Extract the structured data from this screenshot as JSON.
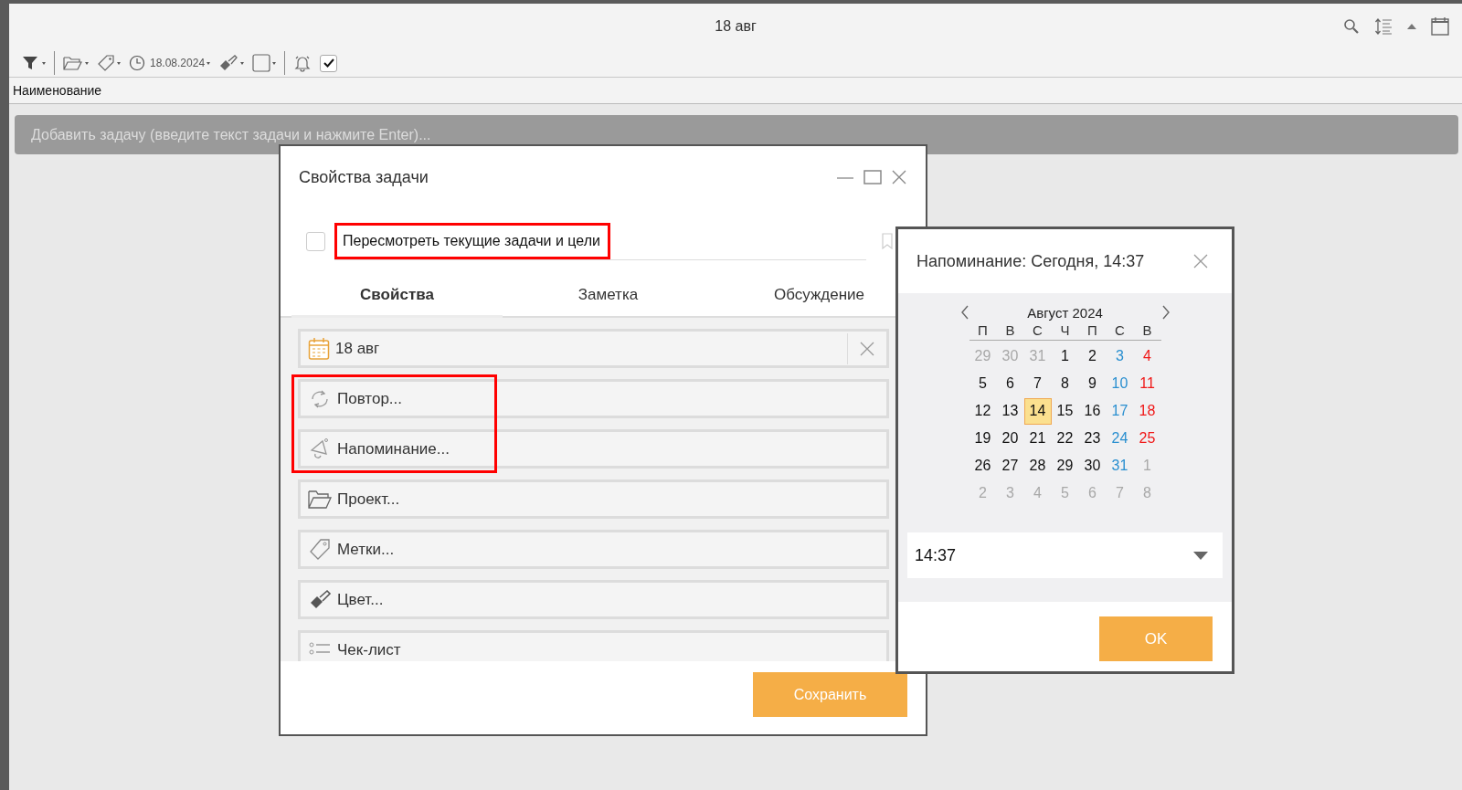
{
  "window": {
    "title": "18 авг"
  },
  "toolbar": {
    "date": "18.08.2024",
    "show_completed": true
  },
  "list": {
    "columns": [
      {
        "label": "Наименование"
      }
    ],
    "add_task": {
      "placeholder": "Добавить задачу (введите текст задачи и нажмите Enter)..."
    }
  },
  "task_dialog": {
    "title": "Свойства задачи",
    "task": {
      "done": false,
      "name": "Пересмотреть текущие задачи и цели",
      "highlighted": true
    },
    "tabs": [
      {
        "label": "Свойства",
        "selected": true
      },
      {
        "label": "Заметка",
        "selected": false
      },
      {
        "label": "Обсуждение",
        "selected": false
      }
    ],
    "fields": [
      {
        "kind": "date",
        "label": "18 авг",
        "highlighted": false
      },
      {
        "kind": "repeat",
        "label": "Повтор...",
        "highlighted": true
      },
      {
        "kind": "reminder",
        "label": "Напоминание...",
        "highlighted": true
      },
      {
        "kind": "project",
        "label": "Проект...",
        "highlighted": false
      },
      {
        "kind": "tags",
        "label": "Метки...",
        "highlighted": false
      },
      {
        "kind": "color",
        "label": "Цвет...",
        "highlighted": false
      },
      {
        "kind": "checklist",
        "label": "Чек-лист",
        "highlighted": false
      }
    ],
    "save_button": "Сохранить"
  },
  "reminder": {
    "title": "Напоминание: Сегодня, 14:37",
    "month": "Август 2024",
    "weekdays": [
      "П",
      "В",
      "С",
      "Ч",
      "П",
      "С",
      "В"
    ],
    "weeks": [
      [
        {
          "day": "29",
          "kind": "other",
          "selected": false
        },
        {
          "day": "30",
          "kind": "other",
          "selected": false
        },
        {
          "day": "31",
          "kind": "other",
          "selected": false
        },
        {
          "day": "1",
          "kind": "weekday",
          "selected": false
        },
        {
          "day": "2",
          "kind": "weekday",
          "selected": false
        },
        {
          "day": "3",
          "kind": "saturday",
          "selected": false
        },
        {
          "day": "4",
          "kind": "sunday",
          "selected": false
        }
      ],
      [
        {
          "day": "5",
          "kind": "weekday",
          "selected": false
        },
        {
          "day": "6",
          "kind": "weekday",
          "selected": false
        },
        {
          "day": "7",
          "kind": "weekday",
          "selected": false
        },
        {
          "day": "8",
          "kind": "weekday",
          "selected": false
        },
        {
          "day": "9",
          "kind": "weekday",
          "selected": false
        },
        {
          "day": "10",
          "kind": "saturday",
          "selected": false
        },
        {
          "day": "11",
          "kind": "sunday",
          "selected": false
        }
      ],
      [
        {
          "day": "12",
          "kind": "weekday",
          "selected": false
        },
        {
          "day": "13",
          "kind": "weekday",
          "selected": false
        },
        {
          "day": "14",
          "kind": "weekday",
          "selected": true
        },
        {
          "day": "15",
          "kind": "weekday",
          "selected": false
        },
        {
          "day": "16",
          "kind": "weekday",
          "selected": false
        },
        {
          "day": "17",
          "kind": "saturday",
          "selected": false
        },
        {
          "day": "18",
          "kind": "sunday",
          "selected": false
        }
      ],
      [
        {
          "day": "19",
          "kind": "weekday",
          "selected": false
        },
        {
          "day": "20",
          "kind": "weekday",
          "selected": false
        },
        {
          "day": "21",
          "kind": "weekday",
          "selected": false
        },
        {
          "day": "22",
          "kind": "weekday",
          "selected": false
        },
        {
          "day": "23",
          "kind": "weekday",
          "selected": false
        },
        {
          "day": "24",
          "kind": "saturday",
          "selected": false
        },
        {
          "day": "25",
          "kind": "sunday",
          "selected": false
        }
      ],
      [
        {
          "day": "26",
          "kind": "weekday",
          "selected": false
        },
        {
          "day": "27",
          "kind": "weekday",
          "selected": false
        },
        {
          "day": "28",
          "kind": "weekday",
          "selected": false
        },
        {
          "day": "29",
          "kind": "weekday",
          "selected": false
        },
        {
          "day": "30",
          "kind": "weekday",
          "selected": false
        },
        {
          "day": "31",
          "kind": "saturday",
          "selected": false
        },
        {
          "day": "1",
          "kind": "other",
          "selected": false
        }
      ],
      [
        {
          "day": "2",
          "kind": "other",
          "selected": false
        },
        {
          "day": "3",
          "kind": "other",
          "selected": false
        },
        {
          "day": "4",
          "kind": "other",
          "selected": false
        },
        {
          "day": "5",
          "kind": "other",
          "selected": false
        },
        {
          "day": "6",
          "kind": "other",
          "selected": false
        },
        {
          "day": "7",
          "kind": "other",
          "selected": false
        },
        {
          "day": "8",
          "kind": "other",
          "selected": false
        }
      ]
    ],
    "time": "14:37",
    "ok_button": "OK"
  }
}
